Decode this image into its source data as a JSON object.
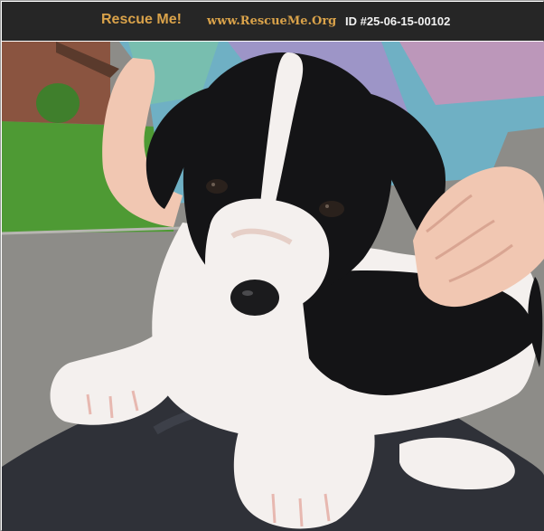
{
  "header": {
    "brand": "Rescue Me!",
    "site": "www.RescueMe.Org",
    "id_text": "ID #25-06-15-00102"
  },
  "photo": {
    "subject": "black-and-white puppy",
    "colors": {
      "header_bg": "#262626",
      "brand_gold": "#d9a24a",
      "id_text": "#f2f2f2"
    }
  }
}
